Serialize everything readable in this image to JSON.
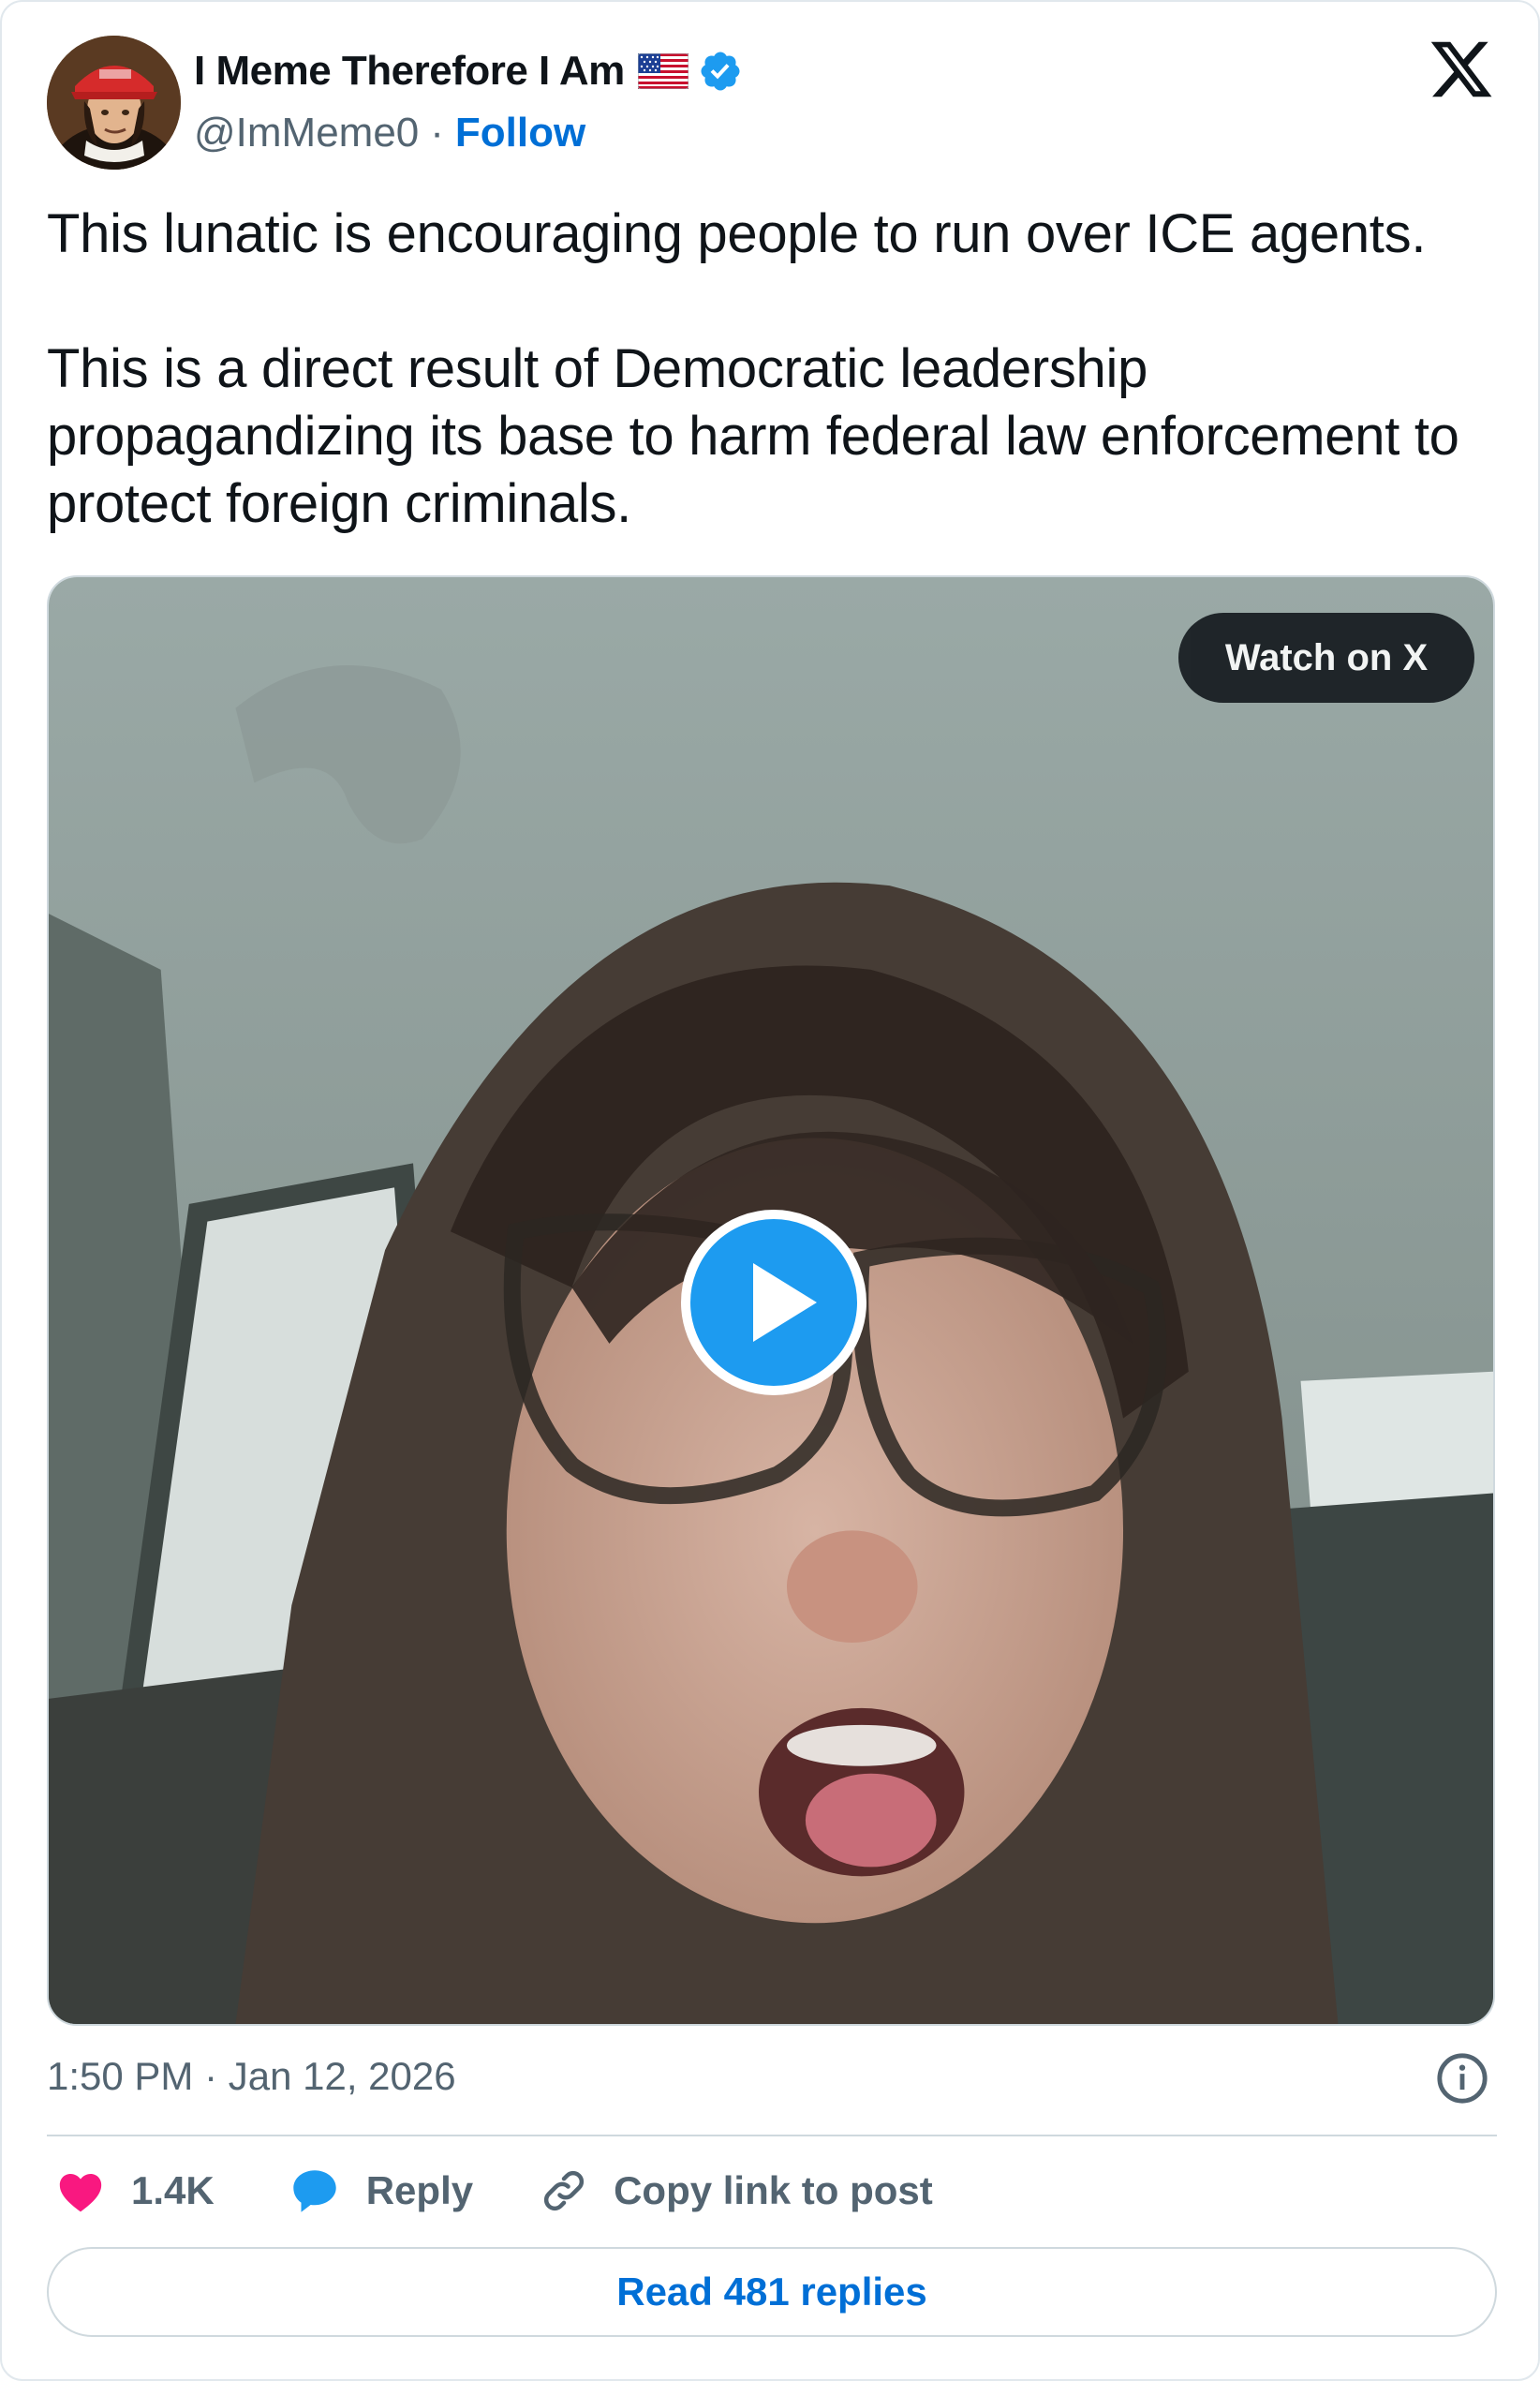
{
  "author": {
    "name": "I Meme Therefore I Am",
    "handle": "@ImMeme0",
    "separator": "·",
    "follow_label": "Follow",
    "avatar_icon": "avatar-portrait-red-cap",
    "flag_icon": "us-flag-icon",
    "verified_icon": "verified-badge-icon"
  },
  "brand": {
    "logo_icon": "x-logo-icon"
  },
  "tweet": {
    "paragraphs": [
      "This lunatic is encouraging people to run over ICE agents.",
      "This is a direct result of Democratic leadership propagandizing its base to harm federal law enforcement to protect foreign criminals."
    ],
    "timestamp": "1:50 PM · Jan 12, 2026"
  },
  "media": {
    "type": "video",
    "watch_label": "Watch on X",
    "play_icon": "play-icon"
  },
  "actions": {
    "likes_count": "1.4K",
    "reply_label": "Reply",
    "copy_link_label": "Copy link to post",
    "read_replies_label": "Read 481 replies"
  },
  "colors": {
    "accent": "#006fd6",
    "verified": "#1d9bf0",
    "heart": "#f91880",
    "text": "#0f1419",
    "muted": "#536471",
    "border": "#cfd9de",
    "play": "#1d9bf0"
  }
}
